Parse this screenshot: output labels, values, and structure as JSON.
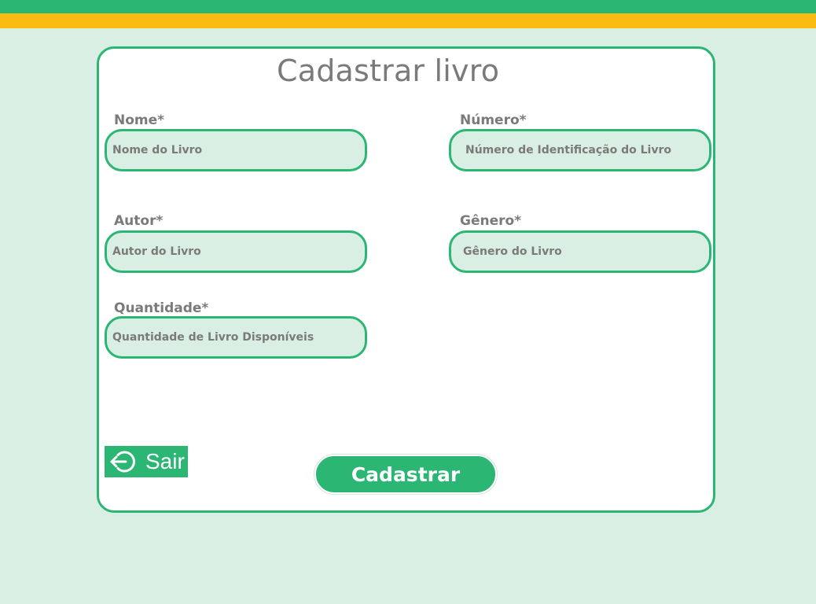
{
  "colors": {
    "primary_green": "#2bb673",
    "accent_yellow": "#fbbb12",
    "background": "#daefe3",
    "text_gray": "#7a7a7a"
  },
  "form": {
    "title": "Cadastrar livro",
    "fields": {
      "nome": {
        "label": "Nome*",
        "placeholder": "Nome do Livro",
        "value": ""
      },
      "numero": {
        "label": "Número*",
        "placeholder": "Número de Identificação do Livro",
        "value": ""
      },
      "autor": {
        "label": "Autor*",
        "placeholder": "Autor do Livro",
        "value": ""
      },
      "genero": {
        "label": "Gênero*",
        "placeholder": "Gênero do Livro",
        "value": ""
      },
      "quantidade": {
        "label": "Quantidade*",
        "placeholder": "Quantidade de Livro Disponíveis",
        "value": ""
      }
    },
    "exit_button": {
      "label": "Sair",
      "icon": "exit-icon"
    },
    "submit_button": {
      "label": "Cadastrar"
    }
  }
}
